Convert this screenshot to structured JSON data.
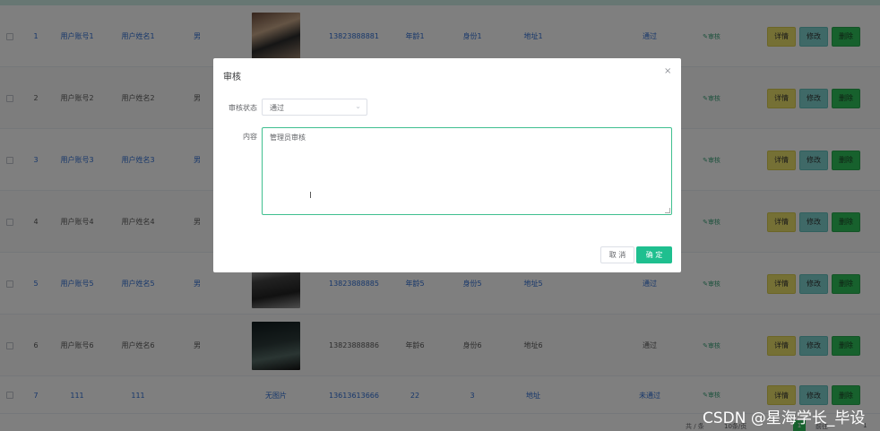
{
  "rows": [
    {
      "idx": "1",
      "account": "用户账号1",
      "name": "用户姓名1",
      "gender": "男",
      "phone": "13823888881",
      "age": "年龄1",
      "id": "身份1",
      "addr": "地址1",
      "status": "通过",
      "audit": "审核",
      "detail": "详情",
      "edit": "修改",
      "del": "删除"
    },
    {
      "idx": "2",
      "account": "用户账号2",
      "name": "用户姓名2",
      "gender": "男",
      "phone": "",
      "age": "",
      "id": "",
      "addr": "",
      "status": "",
      "audit": "审核",
      "detail": "详情",
      "edit": "修改",
      "del": "删除"
    },
    {
      "idx": "3",
      "account": "用户账号3",
      "name": "用户姓名3",
      "gender": "男",
      "phone": "",
      "age": "",
      "id": "",
      "addr": "",
      "status": "",
      "audit": "审核",
      "detail": "详情",
      "edit": "修改",
      "del": "删除"
    },
    {
      "idx": "4",
      "account": "用户账号4",
      "name": "用户姓名4",
      "gender": "男",
      "phone": "",
      "age": "",
      "id": "",
      "addr": "",
      "status": "",
      "audit": "审核",
      "detail": "详情",
      "edit": "修改",
      "del": "删除"
    },
    {
      "idx": "5",
      "account": "用户账号5",
      "name": "用户姓名5",
      "gender": "男",
      "phone": "13823888885",
      "age": "年龄5",
      "id": "身份5",
      "addr": "地址5",
      "status": "通过",
      "audit": "审核",
      "detail": "详情",
      "edit": "修改",
      "del": "删除"
    },
    {
      "idx": "6",
      "account": "用户账号6",
      "name": "用户姓名6",
      "gender": "男",
      "phone": "13823888886",
      "age": "年龄6",
      "id": "身份6",
      "addr": "地址6",
      "status": "通过",
      "audit": "审核",
      "detail": "详情",
      "edit": "修改",
      "del": "删除"
    },
    {
      "idx": "7",
      "account": "111",
      "name": "111",
      "gender": "",
      "photo": "无图片",
      "phone": "13613613666",
      "age": "22",
      "id": "3",
      "addr": "地址",
      "status": "未通过",
      "audit": "审核",
      "detail": "详情",
      "edit": "修改",
      "del": "删除"
    }
  ],
  "pager": {
    "total": "共 / 条",
    "size": "10条/页",
    "current": "1",
    "next": "前往",
    "arrow": "1"
  },
  "dialog": {
    "title": "审核",
    "close": "×",
    "status_label": "审核状态",
    "status_value": "通过",
    "content_label": "内容",
    "content_value": "管理员审核",
    "cancel": "取 消",
    "confirm": "确 定"
  },
  "watermark": "CSDN @星海学长_毕设"
}
